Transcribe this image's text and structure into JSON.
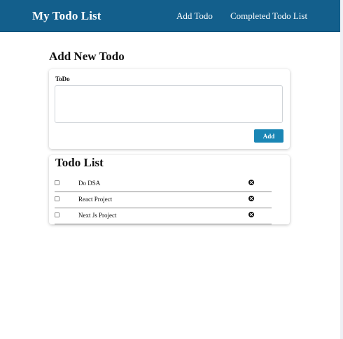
{
  "navbar": {
    "brand": "My Todo List",
    "links": [
      "Add Todo",
      "Completed Todo List"
    ],
    "background": "#135f8c"
  },
  "add_section": {
    "title": "Add New Todo",
    "field_label": "ToDo",
    "textarea_value": "",
    "button_label": "Add",
    "button_color": "#1a86b5"
  },
  "list_section": {
    "title": "Todo List",
    "items": [
      {
        "text": "Do DSA",
        "checked": false
      },
      {
        "text": "React Project",
        "checked": false
      },
      {
        "text": "Next Js Project",
        "checked": false
      }
    ],
    "delete_icon": "circle-x-icon"
  }
}
